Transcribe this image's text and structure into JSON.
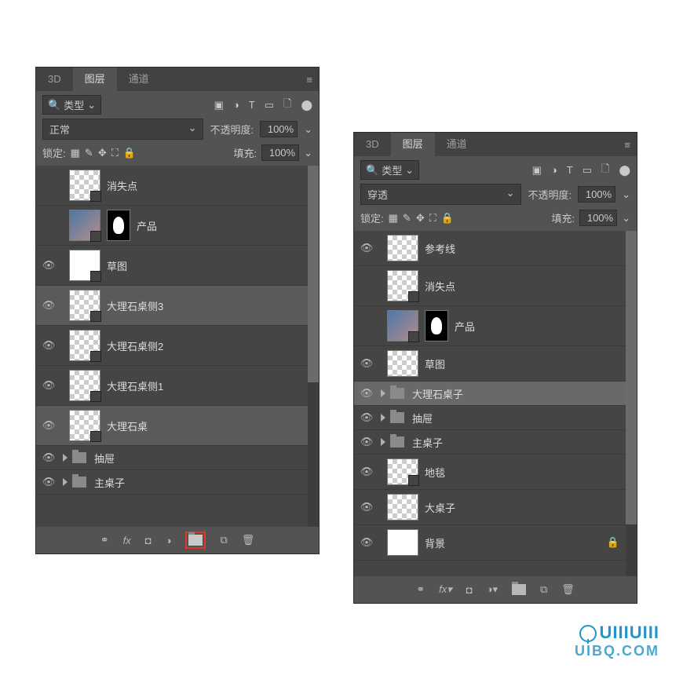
{
  "panel1": {
    "tabs": [
      "3D",
      "图层",
      "通道"
    ],
    "active_tab": 1,
    "filter_prefix": "Q",
    "filter_label": "类型",
    "blend_mode": "正常",
    "opacity_label": "不透明度:",
    "opacity_value": "100%",
    "lock_label": "锁定:",
    "fill_label": "填充:",
    "fill_value": "100%",
    "layers": [
      {
        "visible": false,
        "kind": "thumb",
        "smart": true,
        "checker": true,
        "mask": false,
        "name": "消失点"
      },
      {
        "visible": false,
        "kind": "thumb",
        "smart": true,
        "checker": false,
        "product": true,
        "mask": true,
        "name": "产品"
      },
      {
        "visible": true,
        "kind": "thumb",
        "smart": true,
        "checker": false,
        "mask": false,
        "name": "草图"
      },
      {
        "visible": true,
        "kind": "thumb",
        "smart": true,
        "checker": true,
        "mask": false,
        "name": "大理石桌侧3"
      },
      {
        "visible": true,
        "kind": "thumb",
        "smart": true,
        "checker": true,
        "mask": false,
        "name": "大理石桌侧2"
      },
      {
        "visible": true,
        "kind": "thumb",
        "smart": true,
        "checker": true,
        "mask": false,
        "name": "大理石桌侧1"
      },
      {
        "visible": true,
        "kind": "thumb",
        "smart": true,
        "checker": true,
        "mask": false,
        "name": "大理石桌"
      },
      {
        "visible": true,
        "kind": "folder",
        "name": "抽屉"
      },
      {
        "visible": true,
        "kind": "folder",
        "name": "主桌子"
      }
    ],
    "footer_icons": [
      "link",
      "fx",
      "mask",
      "adjust",
      "folder",
      "new",
      "trash"
    ]
  },
  "panel2": {
    "tabs": [
      "3D",
      "图层",
      "通道"
    ],
    "active_tab": 1,
    "filter_prefix": "Q",
    "filter_label": "类型",
    "blend_mode": "穿透",
    "opacity_label": "不透明度:",
    "opacity_value": "100%",
    "lock_label": "锁定:",
    "fill_label": "填充:",
    "fill_value": "100%",
    "layers": [
      {
        "visible": true,
        "kind": "thumb",
        "smart": false,
        "checker": true,
        "mask": false,
        "name": "参考线"
      },
      {
        "visible": false,
        "kind": "thumb",
        "smart": true,
        "checker": true,
        "mask": false,
        "name": "消失点"
      },
      {
        "visible": false,
        "kind": "thumb",
        "smart": true,
        "checker": false,
        "product": true,
        "mask": true,
        "name": "产品"
      },
      {
        "visible": true,
        "kind": "thumb",
        "smart": false,
        "checker": true,
        "mask": false,
        "name": "草图"
      },
      {
        "visible": true,
        "kind": "folder",
        "selected": true,
        "name": "大理石桌子"
      },
      {
        "visible": true,
        "kind": "folder",
        "name": "抽屉"
      },
      {
        "visible": true,
        "kind": "folder",
        "name": "主桌子"
      },
      {
        "visible": true,
        "kind": "thumb",
        "smart": true,
        "checker": true,
        "mask": false,
        "name": "地毯"
      },
      {
        "visible": true,
        "kind": "thumb",
        "smart": false,
        "checker": true,
        "mask": false,
        "name": "大桌子"
      },
      {
        "visible": true,
        "kind": "thumb",
        "smart": false,
        "checker": false,
        "mask": false,
        "locked": true,
        "name": "背景"
      }
    ],
    "footer_icons": [
      "link",
      "fx",
      "mask",
      "adjust",
      "folder",
      "new",
      "trash"
    ]
  },
  "watermark": {
    "line1": "UIIIUIII",
    "line2": "UIBQ.COM"
  }
}
